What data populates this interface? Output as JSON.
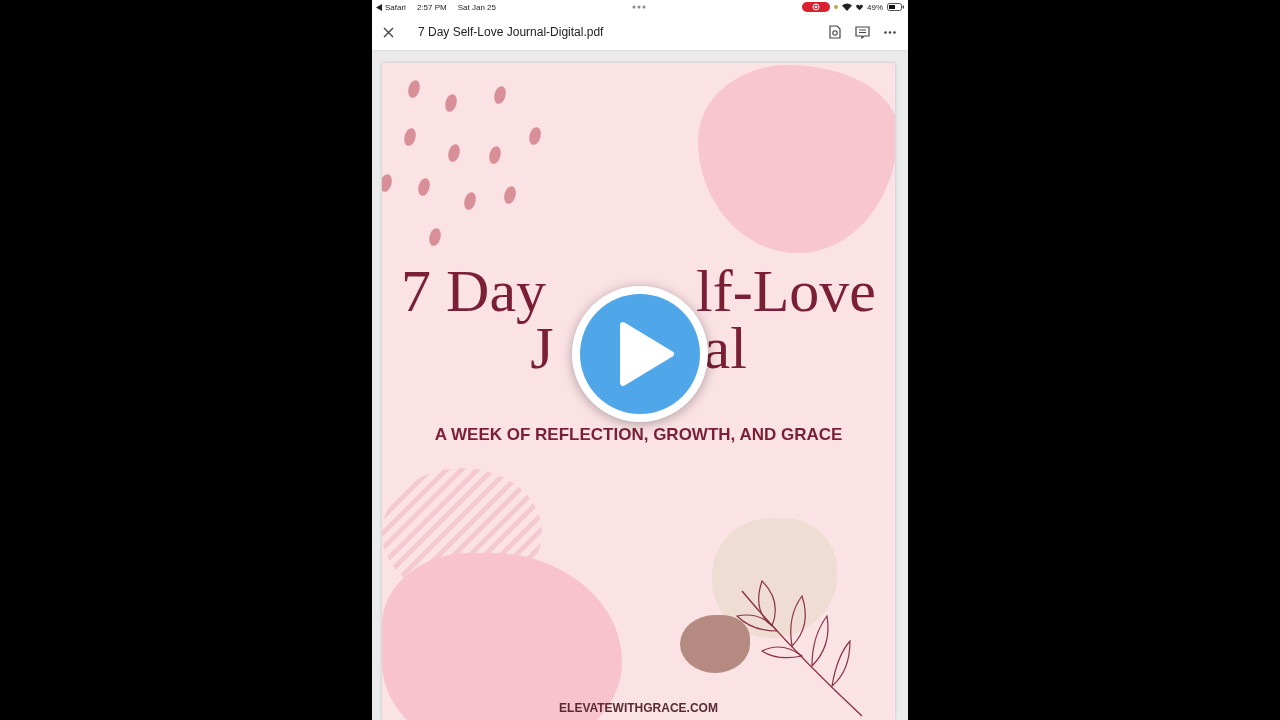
{
  "status_bar": {
    "back_app": "Safari",
    "time": "2:57 PM",
    "date": "Sat Jan 25",
    "battery": "49%"
  },
  "header": {
    "title": "7 Day Self-Love Journal-Digital.pdf"
  },
  "document": {
    "title_lines": [
      [
        "7 Day",
        "lf-Love"
      ],
      [
        "J",
        "al"
      ]
    ],
    "subtitle": "A WEEK OF REFLECTION, GROWTH, AND GRACE",
    "website": "ELEVATEWITHGRACE.COM"
  }
}
